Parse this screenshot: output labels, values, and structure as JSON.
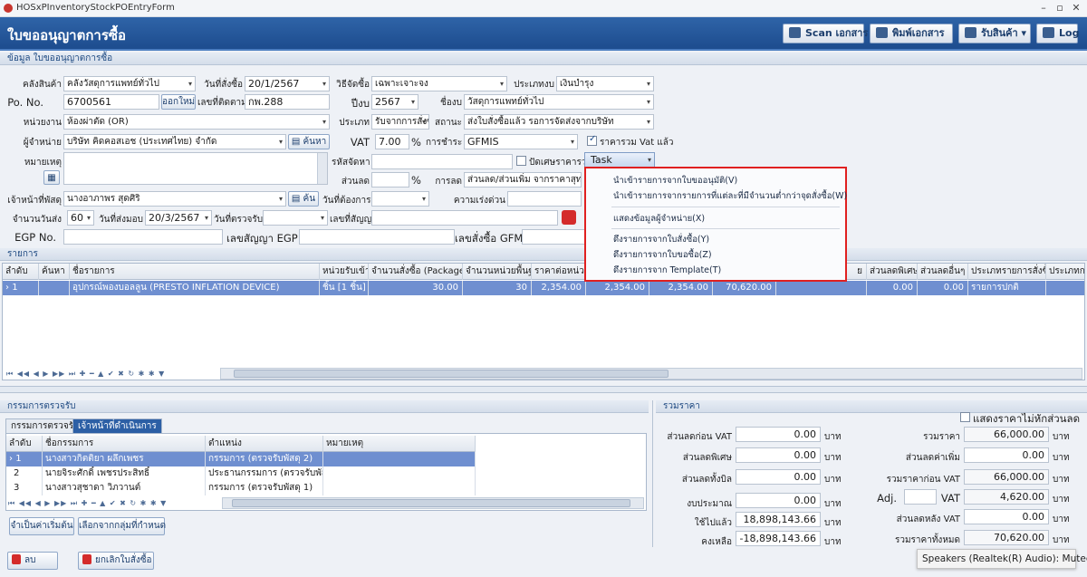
{
  "window": {
    "title": "HOSxPInventoryStockPOEntryForm"
  },
  "header": {
    "title": "ใบขออนุญาตการซื้อ",
    "scan_label": "Scan เอกสาร",
    "print_label": "พิมพ์เอกสาร",
    "receive_label": "รับสินค้า",
    "log_label": "Log"
  },
  "sections": {
    "info": "ข้อมูล ใบขออนุญาตการซื้อ",
    "items": "รายการ",
    "committee": "กรรมการตรวจรับ",
    "summary": "รวมราคา"
  },
  "form": {
    "warehouse_label": "คลังสินค้า",
    "warehouse_value": "คลังวัสดุการแพทย์ทั่วไป",
    "order_date_label": "วันที่สั่งซื้อ",
    "order_date_value": "20/1/2567",
    "method_label": "วิธีจัดซื้อ",
    "method_value": "เฉพาะเจาะจง",
    "budget_type_label": "ประเภทงบ",
    "budget_type_value": "เงินบำรุง",
    "po_no_label": "Po. No.",
    "po_no_value": "6700561",
    "new_no_label": "ออกใหม่",
    "follow_no_label": "เลขที่ติดตาม",
    "follow_no_value": "กพ.288",
    "year_label": "ปีงบ",
    "year_value": "2567",
    "budget_name_label": "ชื่องบ",
    "budget_name_value": "วัสดุการแพทย์ทั่วไป",
    "dept_label": "หน่วยงาน",
    "dept_value": "ห้องผ่าตัด (OR)",
    "category_label": "ประเภท",
    "category_value": "รับจากการสั่งซื้",
    "status_label": "สถานะ",
    "status_value": "ส่งใบสั่งซื้อแล้ว รอการจัดส่งจากบริษัท",
    "vendor_label": "ผู้จำหน่าย",
    "vendor_value": "บริษัท คิดคอสเอช (ประเทศไทย) จำกัด",
    "search_label": "ค้นหา",
    "vat_label": "VAT",
    "vat_value": "7.00",
    "percent": "%",
    "payment_label": "การชำระ",
    "payment_value": "GFMIS",
    "include_vat_label": "ราคารวม Vat แล้ว",
    "note_label": "หมายเหตุ",
    "purchase_code_label": "รหัสจัดหา",
    "round_label": "ปัดเศษราคารวม",
    "task_label": "Task",
    "discount_label": "ส่วนลด",
    "discount_type_label": "การลด",
    "discount_type_value": "ส่วนลด/ส่วนเพิ่ม จากราคาสุทธิ",
    "officer_label": "เจ้าหน้าที่พัสดุ",
    "officer_value": "นางอาภาพร สุดศิริ",
    "search2_label": "ค้น",
    "need_date_label": "วันที่ต้องการ",
    "urgency_label": "ความเร่งด่วน",
    "days_label": "จำนวนวันส่ง",
    "days_value": "60",
    "deliver_date_label": "วันที่ส่งมอบ",
    "deliver_date_value": "20/3/2567",
    "inspect_date_label": "วันที่ตรวจรับ",
    "contract_label": "เลขที่สัญญา",
    "egp_label": "EGP No.",
    "egp_contract_label": "เลขสัญญา EGP",
    "gfmis_label": "เลขสั่งซื้อ GFMIS"
  },
  "task_menu": [
    "นำเข้ารายการจากใบขออนุมัติ(V)",
    "นำเข้ารายการจากรายการที่แต่ละที่มีจำนวนต่ำกว่าจุดสั่งซื้อ(W)",
    "แสดงข้อมูลผู้จำหน่าย(X)",
    "ดึงรายการจากใบสั่งซื้อ(Y)",
    "ดึงรายการจากใบขอซื้อ(Z)",
    "ดึงรายการจาก Template(T)"
  ],
  "items": {
    "columns": [
      "ลำดับ",
      "ค้นหา",
      "ชื่อรายการ",
      "หน่วยรับเข้า",
      "จำนวนสั่งซื้อ (Package)",
      "จำนวนหน่วยพื้นฐาน",
      "ราคาต่อหน่วย",
      "",
      "",
      "",
      "ย",
      "ส่วนลดพิเศษ",
      "ส่วนลดอื่นๆ",
      "ประเภทรายการสั่งซื้อ",
      "ประเภทการ"
    ],
    "rows": [
      {
        "no": "1",
        "name": "อุปกรณ์พองบอลลูน (PRESTO INFLATION DEVICE)",
        "unit": "ชิ้น [1 ชิ้น]",
        "qty": "30.00",
        "base": "30",
        "price": "2,354.00",
        "c1": "2,354.00",
        "c2": "2,354.00",
        "c3": "70,620.00",
        "sp": "0.00",
        "other": "0.00",
        "type": "รายการปกติ"
      }
    ]
  },
  "committee": {
    "tabs": [
      "กรรมการตรวจรับ",
      "เจ้าหน้าที่ดำเนินการ"
    ],
    "columns": [
      "ลำดับ",
      "ชื่อกรรมการ",
      "ตำแหน่ง",
      "หมายเหตุ"
    ],
    "rows": [
      {
        "no": "1",
        "name": "นางสาวกิตติยา ผลึกเพชร",
        "pos": "กรรมการ (ตรวจรับพัสดุ 2)"
      },
      {
        "no": "2",
        "name": "นายจิระศักดิ์ เพชรประสิทธิ์",
        "pos": "ประธานกรรมการ (ตรวจรับพัสดุ)"
      },
      {
        "no": "3",
        "name": "นางสาวสุชาดา วิภวานต์",
        "pos": "กรรมการ (ตรวจรับพัสดุ 1)"
      }
    ],
    "default_btn": "จำเป็นค่าเริ่มต้น",
    "choose_btn": "เลือกจากกลุ่มที่กำหนด"
  },
  "summary": {
    "no_discount_label": "แสดงราคาไม่หักส่วนลด",
    "disc_before_vat_label": "ส่วนลดก่อน VAT",
    "disc_before_vat": "0.00",
    "disc_special_label": "ส่วนลดพิเศษ",
    "disc_special": "0.00",
    "disc_total_label": "ส่วนลดทั้งบิล",
    "disc_total": "0.00",
    "budget_label": "งบประมาณ",
    "budget": "0.00",
    "used_label": "ใช้ไปแล้ว",
    "used": "18,898,143.66",
    "remain_label": "คงเหลือ",
    "remain": "-18,898,143.66",
    "total_price_label": "รวมราคา",
    "total_price": "66,000.00",
    "disc_add_label": "ส่วนลดค่าเพิ่ม",
    "disc_add": "0.00",
    "before_vat_label": "รวมราคาก่อน VAT",
    "before_vat": "66,000.00",
    "adj_label": "Adj.",
    "vat_label": "VAT",
    "vat": "4,620.00",
    "after_vat_label": "ส่วนลดหลัง VAT",
    "after_vat": "0.00",
    "grand_total_label": "รวมราคาทั้งหมด",
    "grand_total": "70,620.00",
    "baht": "บาท"
  },
  "footer": {
    "delete_label": "ลบ",
    "cancel_label": "ยกเลิกใบสั่งซื้อ"
  },
  "toast": "Speakers (Realtek(R) Audio): Muted"
}
